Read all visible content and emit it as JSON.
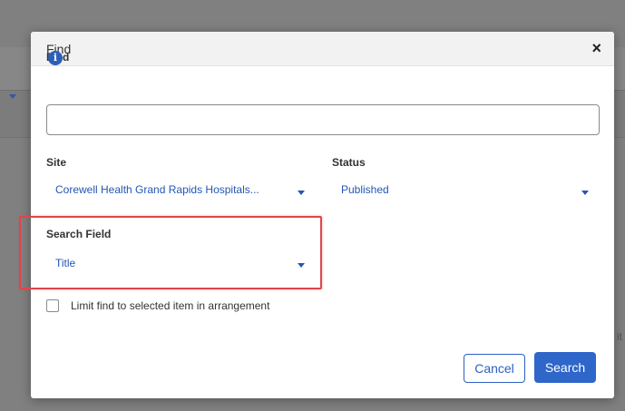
{
  "dialog": {
    "title": "Find",
    "close_label": "×"
  },
  "find": {
    "label": "Find",
    "info_glyph": "i",
    "value": "",
    "placeholder": ""
  },
  "site": {
    "label": "Site",
    "selected": "Corewell Health Grand Rapids Hospitals..."
  },
  "status": {
    "label": "Status",
    "selected": "Published"
  },
  "search_field": {
    "label": "Search Field",
    "selected": "Title"
  },
  "limit_checkbox": {
    "label": "Limit find to selected item in arrangement",
    "checked": false
  },
  "buttons": {
    "cancel": "Cancel",
    "search": "Search"
  },
  "background": {
    "partial_text": "it"
  },
  "colors": {
    "accent": "#2e66c9",
    "link": "#2456b4",
    "highlight": "#e0454a",
    "overlay": "#808080"
  },
  "icons": {
    "info": "info-icon",
    "close": "close-icon",
    "dropdown": "chevron-down-icon"
  }
}
